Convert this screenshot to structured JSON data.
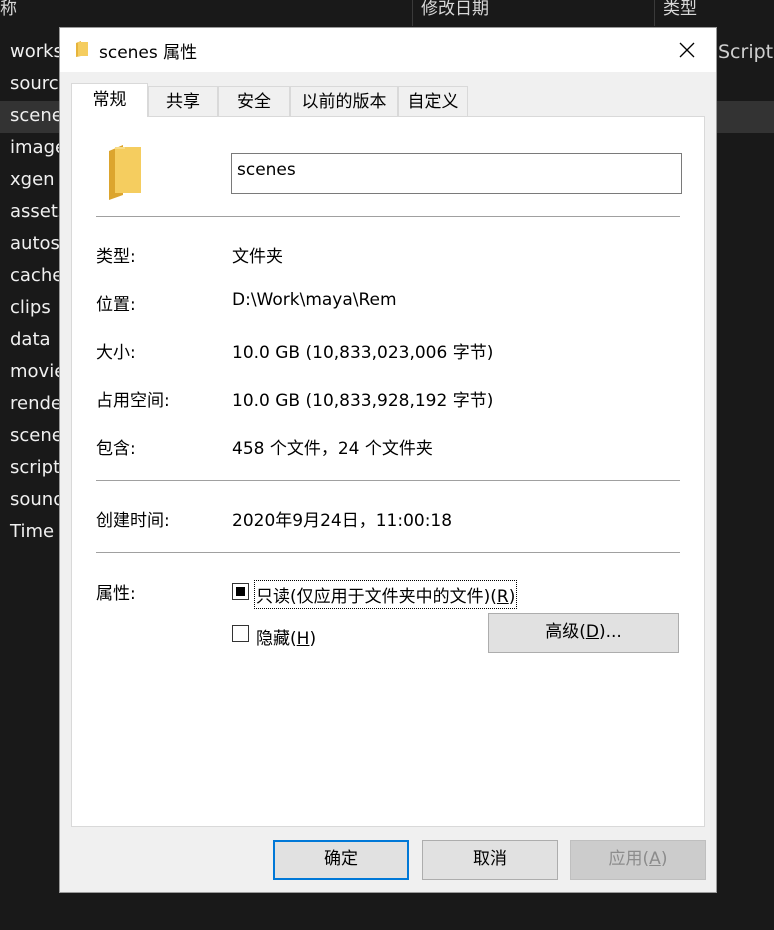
{
  "explorer": {
    "columns": [
      "称",
      "修改日期",
      "类型"
    ],
    "right_text": "Script",
    "rows": [
      "works",
      "source",
      "scene",
      "image",
      "xgen",
      "assets",
      "autos",
      "cache",
      "clips",
      "data",
      "movie",
      "rende",
      "scene",
      "script",
      "sound",
      "Time"
    ]
  },
  "dialog": {
    "title": "scenes 属性",
    "tabs": [
      "常规",
      "共享",
      "安全",
      "以前的版本",
      "自定义"
    ],
    "name_value": "scenes",
    "props": {
      "type_label": "类型:",
      "type_value": "文件夹",
      "location_label": "位置:",
      "location_value": "D:\\Work\\maya\\Rem",
      "size_label": "大小:",
      "size_value": "10.0 GB (10,833,023,006 字节)",
      "disk_label": "占用空间:",
      "disk_value": "10.0 GB (10,833,928,192 字节)",
      "contains_label": "包含:",
      "contains_value": "458 个文件，24 个文件夹",
      "created_label": "创建时间:",
      "created_value": "2020年9月24日，11:00:18",
      "attr_label": "属性:"
    },
    "readonly_text": "只读(仅应用于文件夹中的文件)(",
    "readonly_key": "R",
    "readonly_end": ")",
    "readonly_state": "indeterminate",
    "hidden_text": "隐藏(",
    "hidden_key": "H",
    "hidden_end": ")",
    "hidden_checked": false,
    "advanced_text": "高级(",
    "advanced_key": "D",
    "advanced_end": ")...",
    "buttons": {
      "ok": "确定",
      "cancel": "取消",
      "apply_text": "应用(",
      "apply_key": "A",
      "apply_end": ")"
    }
  },
  "colors": {
    "accent": "#0078d7",
    "folder": "#f5cd5f",
    "explorer_bg": "#191919"
  },
  "icons": [
    "folder-icon",
    "close-icon"
  ]
}
